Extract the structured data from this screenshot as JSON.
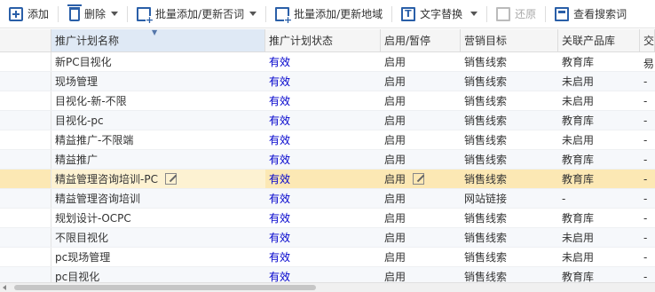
{
  "toolbar": {
    "add": "添加",
    "delete": "删除",
    "batch_add_negative": "批量添加/更新否词",
    "batch_add_region": "批量添加/更新地域",
    "text_replace": "文字替换",
    "restore": "还原",
    "view_search_terms": "查看搜索词"
  },
  "table": {
    "columns": [
      "推广计划名称",
      "推广计划状态",
      "启用/暂停",
      "营销目标",
      "关联产品库",
      "交易"
    ],
    "rows": [
      {
        "name": "新PC目视化",
        "status": "有效",
        "enabled": "启用",
        "goal": "销售线索",
        "product": "教育库",
        "extra": "-"
      },
      {
        "name": "现场管理",
        "status": "有效",
        "enabled": "启用",
        "goal": "销售线索",
        "product": "未启用",
        "extra": "-"
      },
      {
        "name": "目视化-新-不限",
        "status": "有效",
        "enabled": "启用",
        "goal": "销售线索",
        "product": "未启用",
        "extra": "-"
      },
      {
        "name": "目视化-pc",
        "status": "有效",
        "enabled": "启用",
        "goal": "销售线索",
        "product": "教育库",
        "extra": "-"
      },
      {
        "name": "精益推广-不限端",
        "status": "有效",
        "enabled": "启用",
        "goal": "销售线索",
        "product": "未启用",
        "extra": "-"
      },
      {
        "name": "精益推广",
        "status": "有效",
        "enabled": "启用",
        "goal": "销售线索",
        "product": "教育库",
        "extra": "-"
      },
      {
        "name": "精益管理咨询培训-PC",
        "status": "有效",
        "enabled": "启用",
        "goal": "销售线索",
        "product": "教育库",
        "extra": "-"
      },
      {
        "name": "精益管理咨询培训",
        "status": "有效",
        "enabled": "启用",
        "goal": "网站链接",
        "product": "-",
        "extra": "-"
      },
      {
        "name": "规划设计-OCPC",
        "status": "有效",
        "enabled": "启用",
        "goal": "销售线索",
        "product": "教育库",
        "extra": "-"
      },
      {
        "name": "不限目视化",
        "status": "有效",
        "enabled": "启用",
        "goal": "销售线索",
        "product": "未启用",
        "extra": "-"
      },
      {
        "name": "pc现场管理",
        "status": "有效",
        "enabled": "启用",
        "goal": "销售线索",
        "product": "未启用",
        "extra": "-"
      },
      {
        "name": "pc目视化",
        "status": "有效",
        "enabled": "启用",
        "goal": "销售线索",
        "product": "教育库",
        "extra": "-"
      }
    ]
  },
  "colors": {
    "status_text": "#0000cc",
    "highlight_row": "#fce8b4",
    "header_bg": "#f5f5f5",
    "icon_blue": "#2a5fa8"
  }
}
